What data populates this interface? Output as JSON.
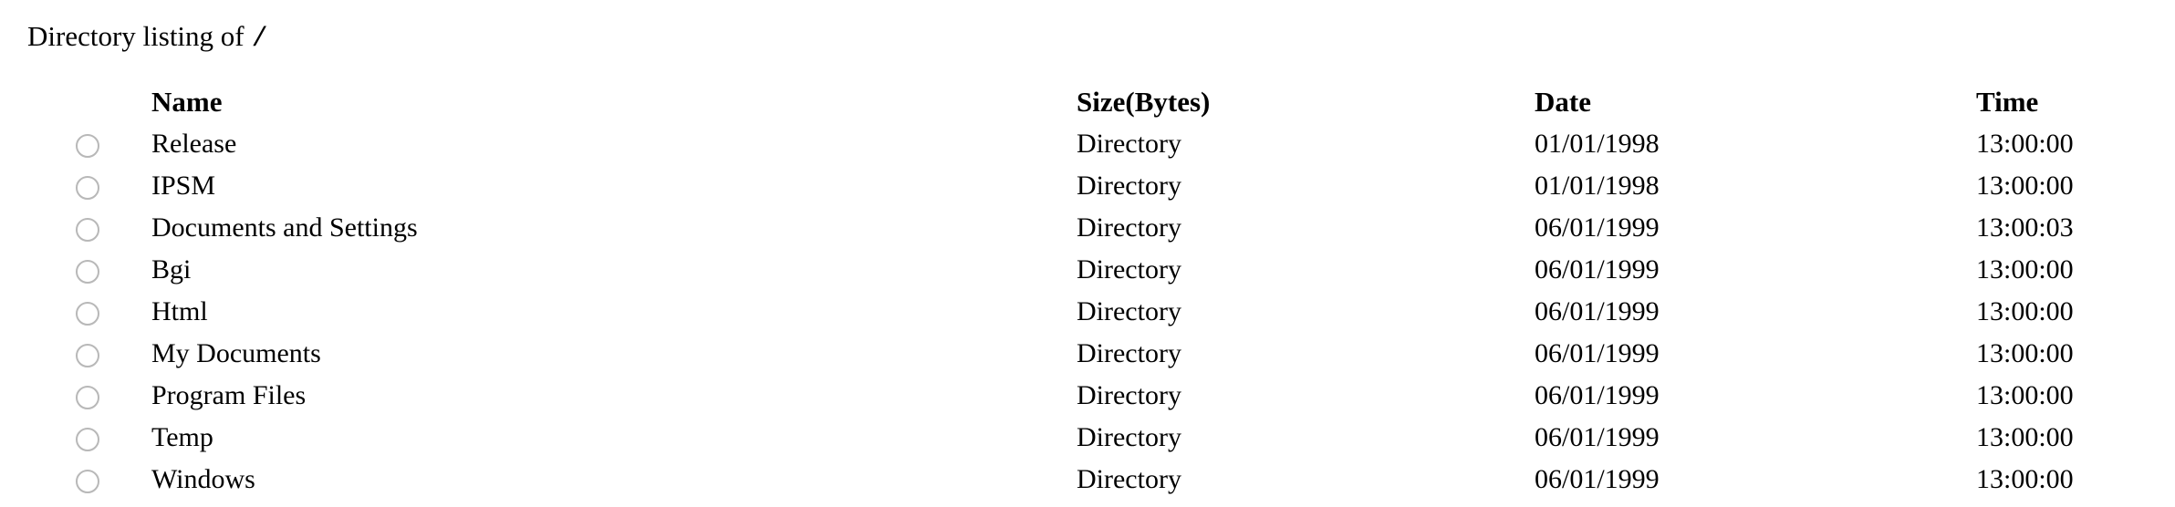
{
  "heading": {
    "label": "Directory listing of",
    "path": "/"
  },
  "table": {
    "columns": {
      "name": "Name",
      "size": "Size(Bytes)",
      "date": "Date",
      "time": "Time"
    },
    "rows": [
      {
        "name": "Release",
        "size": "Directory",
        "date": "01/01/1998",
        "time": "13:00:00",
        "selected": false
      },
      {
        "name": "IPSM",
        "size": "Directory",
        "date": "01/01/1998",
        "time": "13:00:00",
        "selected": false
      },
      {
        "name": "Documents and Settings",
        "size": "Directory",
        "date": "06/01/1999",
        "time": "13:00:03",
        "selected": false
      },
      {
        "name": "Bgi",
        "size": "Directory",
        "date": "06/01/1999",
        "time": "13:00:00",
        "selected": false
      },
      {
        "name": "Html",
        "size": "Directory",
        "date": "06/01/1999",
        "time": "13:00:00",
        "selected": false
      },
      {
        "name": "My Documents",
        "size": "Directory",
        "date": "06/01/1999",
        "time": "13:00:00",
        "selected": false
      },
      {
        "name": "Program Files",
        "size": "Directory",
        "date": "06/01/1999",
        "time": "13:00:00",
        "selected": false
      },
      {
        "name": "Temp",
        "size": "Directory",
        "date": "06/01/1999",
        "time": "13:00:00",
        "selected": false
      },
      {
        "name": "Windows",
        "size": "Directory",
        "date": "06/01/1999",
        "time": "13:00:00",
        "selected": false
      }
    ]
  }
}
